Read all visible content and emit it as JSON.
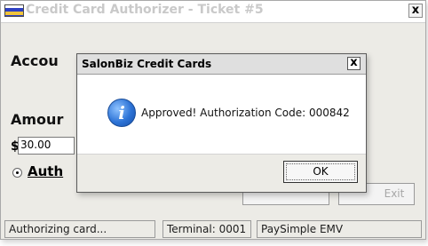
{
  "window": {
    "title": "Credit Card Authorizer - Ticket #5",
    "close_label": "x"
  },
  "form": {
    "account_label": "Accou",
    "amount_label": "Amour",
    "currency_symbol": "$",
    "amount_value": "30.00",
    "auth_option_label": "Auth",
    "exit_label": "Exit"
  },
  "statusbar": {
    "message": "Authorizing card...",
    "terminal": "Terminal: 0001",
    "processor": "PaySimple EMV"
  },
  "dialog": {
    "title": "SalonBiz Credit Cards",
    "close_label": "x",
    "icon": "info-icon",
    "icon_glyph": "i",
    "message": "Approved!  Authorization Code: 000842",
    "ok_label": "OK"
  },
  "colors": {
    "window_bg": "#ecebe6",
    "info_icon_blue": "#2d73d6"
  }
}
